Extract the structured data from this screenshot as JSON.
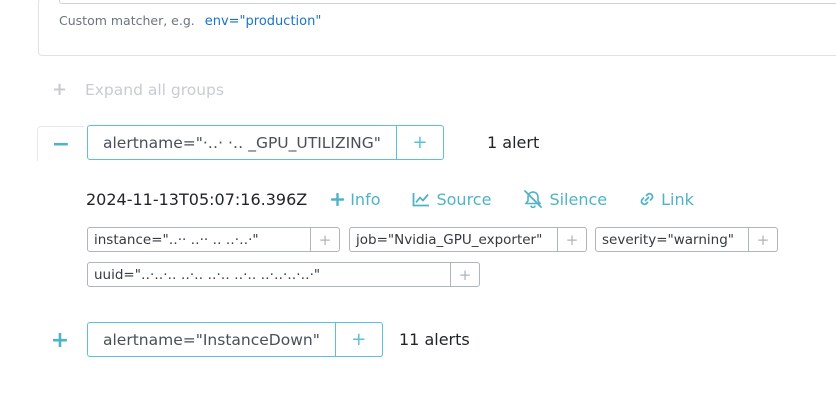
{
  "filter": {
    "hint_label": "Custom matcher, e.g.",
    "hint_example": "env=\"production\""
  },
  "expand_all": {
    "icon": "+",
    "label": "Expand all groups"
  },
  "groups": [
    {
      "toggle": "−",
      "expanded": true,
      "matcher_label": "alertname=\"·‥· ·‥ _GPU_UTILIZING\"",
      "add_symbol": "+",
      "count": "1 alert",
      "alert": {
        "timestamp": "2024-11-13T05:07:16.396Z",
        "actions": {
          "info": "Info",
          "source": "Source",
          "silence": "Silence",
          "link": "Link"
        },
        "labels": [
          "instance=\"‥·· ‥·· ‥ ‥·‥·\"",
          "job=\"Nvidia_GPU_exporter\"",
          "severity=\"warning\"",
          "uuid=\"‥·‥·‥ ‥·‥ ‥·‥ ‥·‥ ‥·‥·‥·‥·\""
        ],
        "label_add_symbol": "+"
      }
    },
    {
      "toggle": "+",
      "expanded": false,
      "matcher_label": "alertname=\"InstanceDown\"",
      "add_symbol": "+",
      "count": "11 alerts"
    }
  ],
  "colors": {
    "accent": "#4fb3c8",
    "matcher_border": "#5bc0d9",
    "muted": "#c8ccd0"
  }
}
